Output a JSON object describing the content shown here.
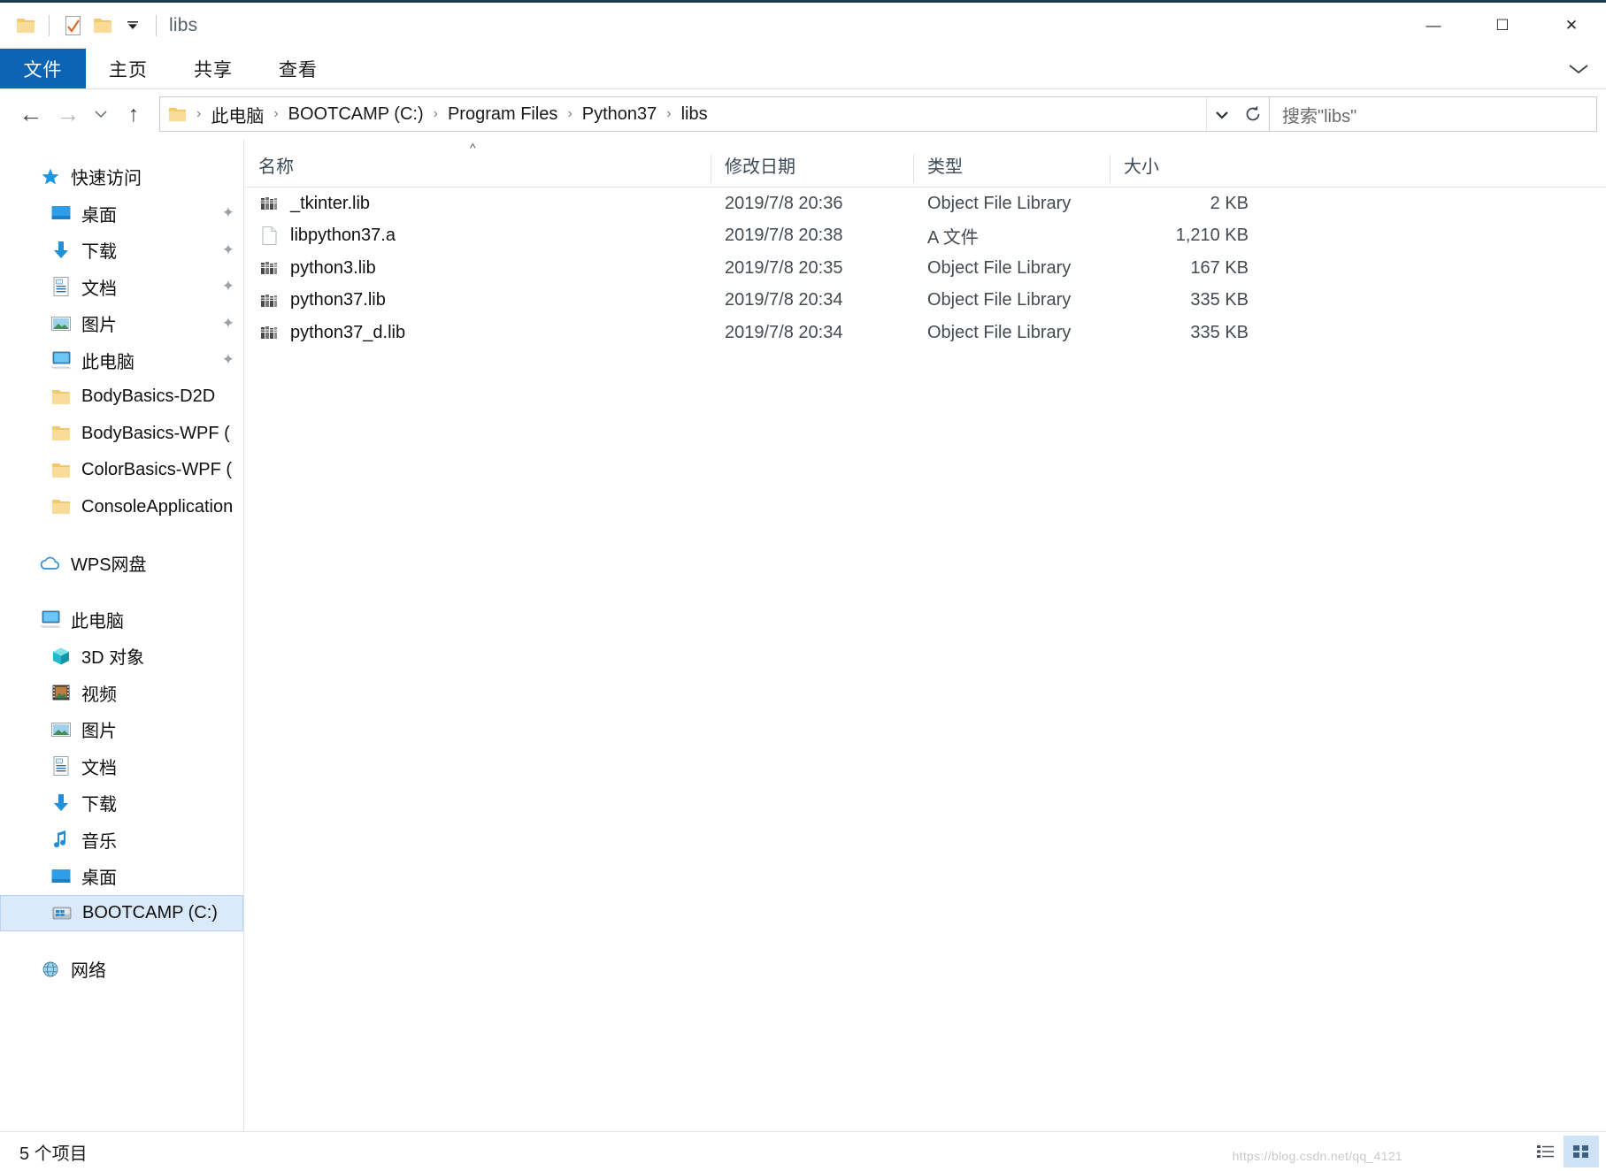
{
  "window": {
    "title": "libs",
    "quick_access_icons": [
      "folder-icon",
      "properties-icon",
      "new-folder-icon",
      "customize-qat-chevron-icon"
    ],
    "controls": {
      "minimize": "—",
      "maximize": "☐",
      "close": "✕"
    }
  },
  "ribbon": {
    "tabs": [
      {
        "label": "文件",
        "active": true
      },
      {
        "label": "主页",
        "active": false
      },
      {
        "label": "共享",
        "active": false
      },
      {
        "label": "查看",
        "active": false
      }
    ],
    "expand_icon": "chevron-down-icon"
  },
  "navigation": {
    "back_icon": "arrow-left-icon",
    "forward_icon": "arrow-right-icon",
    "history_icon": "chevron-down-icon",
    "up_icon": "arrow-up-icon",
    "breadcrumbs": [
      "此电脑",
      "BOOTCAMP (C:)",
      "Program Files",
      "Python37",
      "libs"
    ],
    "separator": "›",
    "dropdown_icon": "chevron-down-icon",
    "refresh_icon": "refresh-icon"
  },
  "search": {
    "placeholder": "搜索\"libs\"",
    "value": "搜索\"libs\""
  },
  "sidebar": {
    "items": [
      {
        "label": "快速访问",
        "icon": "star-icon",
        "level": 0,
        "pinned": false,
        "selected": false,
        "spacer_before": false
      },
      {
        "label": "桌面",
        "icon": "desktop-icon",
        "level": 1,
        "pinned": true,
        "selected": false,
        "spacer_before": false
      },
      {
        "label": "下载",
        "icon": "download-icon",
        "level": 1,
        "pinned": true,
        "selected": false,
        "spacer_before": false
      },
      {
        "label": "文档",
        "icon": "document-icon",
        "level": 1,
        "pinned": true,
        "selected": false,
        "spacer_before": false
      },
      {
        "label": "图片",
        "icon": "pictures-icon",
        "level": 1,
        "pinned": true,
        "selected": false,
        "spacer_before": false
      },
      {
        "label": "此电脑",
        "icon": "this-pc-icon",
        "level": 1,
        "pinned": true,
        "selected": false,
        "spacer_before": false
      },
      {
        "label": "BodyBasics-D2D",
        "icon": "folder-icon",
        "level": 1,
        "pinned": false,
        "selected": false,
        "spacer_before": false
      },
      {
        "label": "BodyBasics-WPF  (",
        "icon": "folder-icon",
        "level": 1,
        "pinned": false,
        "selected": false,
        "spacer_before": false
      },
      {
        "label": "ColorBasics-WPF  (",
        "icon": "folder-icon",
        "level": 1,
        "pinned": false,
        "selected": false,
        "spacer_before": false
      },
      {
        "label": "ConsoleApplication",
        "icon": "folder-icon",
        "level": 1,
        "pinned": false,
        "selected": false,
        "spacer_before": false
      },
      {
        "label": "WPS网盘",
        "icon": "cloud-icon",
        "level": 0,
        "pinned": false,
        "selected": false,
        "spacer_before": true
      },
      {
        "label": "此电脑",
        "icon": "this-pc-icon",
        "level": 0,
        "pinned": false,
        "selected": false,
        "spacer_before": true
      },
      {
        "label": "3D 对象",
        "icon": "3d-objects-icon",
        "level": 1,
        "pinned": false,
        "selected": false,
        "spacer_before": false
      },
      {
        "label": "视频",
        "icon": "videos-icon",
        "level": 1,
        "pinned": false,
        "selected": false,
        "spacer_before": false
      },
      {
        "label": "图片",
        "icon": "pictures-icon",
        "level": 1,
        "pinned": false,
        "selected": false,
        "spacer_before": false
      },
      {
        "label": "文档",
        "icon": "document-icon",
        "level": 1,
        "pinned": false,
        "selected": false,
        "spacer_before": false
      },
      {
        "label": "下载",
        "icon": "download-icon",
        "level": 1,
        "pinned": false,
        "selected": false,
        "spacer_before": false
      },
      {
        "label": "音乐",
        "icon": "music-icon",
        "level": 1,
        "pinned": false,
        "selected": false,
        "spacer_before": false
      },
      {
        "label": "桌面",
        "icon": "desktop-icon",
        "level": 1,
        "pinned": false,
        "selected": false,
        "spacer_before": false
      },
      {
        "label": "BOOTCAMP (C:)",
        "icon": "drive-icon",
        "level": 1,
        "pinned": false,
        "selected": true,
        "spacer_before": false
      },
      {
        "label": "网络",
        "icon": "network-icon",
        "level": 0,
        "pinned": false,
        "selected": false,
        "spacer_before": true
      }
    ]
  },
  "file_list": {
    "columns": [
      {
        "key": "name",
        "label": "名称",
        "sorted": true,
        "sort_dir": "asc"
      },
      {
        "key": "date",
        "label": "修改日期",
        "sorted": false
      },
      {
        "key": "type",
        "label": "类型",
        "sorted": false
      },
      {
        "key": "size",
        "label": "大小",
        "sorted": false
      }
    ],
    "rows": [
      {
        "name": "_tkinter.lib",
        "icon": "lib-file-icon",
        "date": "2019/7/8 20:36",
        "type": "Object File Library",
        "size": "2 KB"
      },
      {
        "name": "libpython37.a",
        "icon": "generic-file-icon",
        "date": "2019/7/8 20:38",
        "type": "A 文件",
        "size": "1,210 KB"
      },
      {
        "name": "python3.lib",
        "icon": "lib-file-icon",
        "date": "2019/7/8 20:35",
        "type": "Object File Library",
        "size": "167 KB"
      },
      {
        "name": "python37.lib",
        "icon": "lib-file-icon",
        "date": "2019/7/8 20:34",
        "type": "Object File Library",
        "size": "335 KB"
      },
      {
        "name": "python37_d.lib",
        "icon": "lib-file-icon",
        "date": "2019/7/8 20:34",
        "type": "Object File Library",
        "size": "335 KB"
      }
    ]
  },
  "status": {
    "item_count_text": "5 个项目",
    "views": [
      {
        "name": "details-view-button",
        "icon": "details-view-icon",
        "active": false
      },
      {
        "name": "large-icons-view-button",
        "icon": "large-icons-view-icon",
        "active": true
      }
    ],
    "watermark": "https://blog.csdn.net/qq_4121"
  },
  "colors": {
    "accent": "#0c64b4",
    "selection": "#dbeafb",
    "selection_border": "#b6d3f0",
    "folder_yellow": "#f6d27f",
    "icon_blue": "#1f96e0"
  }
}
